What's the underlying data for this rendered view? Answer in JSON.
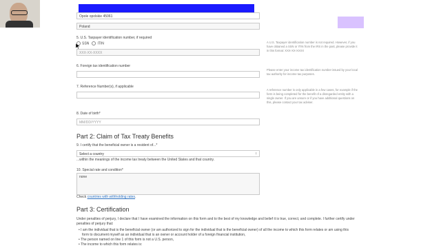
{
  "address": {
    "city_line": "Opole opolskie 45061",
    "country": "Poland"
  },
  "q5": {
    "label": "5. U.S. Taxpayer identification number, if required",
    "radio_ssn": "SSN",
    "radio_itin": "ITIN",
    "placeholder": "XXX-XX-XXXX",
    "help": "A U.S. Taxpayer identification number is not required. However, if you have obtained a SSN or ITIN from the IRS in the past, please provide it in this format: XXX-XX-XXXX"
  },
  "q6": {
    "label": "6. Foreign tax identification number",
    "help": "Please enter your income tax identification number issued by your local tax authority for income tax purposes."
  },
  "q7": {
    "label": "7. Reference Number(s), if applicable",
    "help": "A reference number is only applicable in a few cases, for example if the form is being completed for the benefit of a disregarded entity with a single owner. If you are unsure or if you have additional questions on this, please contact your tax adviser."
  },
  "q8": {
    "label": "8. Date of birth*",
    "placeholder": "MM/DD/YYYY"
  },
  "part2": {
    "title": "Part 2: Claim of Tax Treaty Benefits",
    "q9_label": "9. I certify that the beneficial owner is a resident of...*",
    "q9_select": "Select a country",
    "q9_after": "...within the meanings of the income tax treaty between the United States and that country.",
    "q10_label": "10. Special rate and condition*",
    "q10_value": "none",
    "check_prefix": "Check",
    "check_link": "countries with withholding rates",
    "check_suffix": "."
  },
  "part3": {
    "title": "Part 3: Certification",
    "intro_line1": "Under penalties of perjury, I declare that I have examined the information on this form and to the best of my knowledge and belief it is true, correct, and complete. I further certify under",
    "intro_line2": "penalties of perjury that:",
    "bullets": [
      "I am the individual that is the beneficial owner (or am authorized to sign for the individual that is the beneficial owner) of all the income to which this form relates or am using this",
      "form to document myself as an individual that is an owner or account holder of a foreign financial institution,",
      "The person named on line 1 of this form is not a U.S. person,",
      "The income to which this form relates is:"
    ]
  },
  "colors": {
    "highlight_blue": "#1a1aff",
    "lavender_box": "#d9c2ff"
  }
}
